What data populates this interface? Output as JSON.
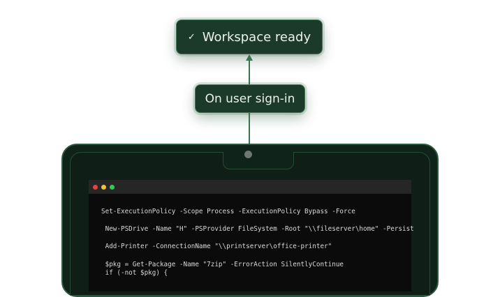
{
  "workflow": {
    "result": {
      "check_glyph": "✓",
      "label": "Workspace ready"
    },
    "trigger": {
      "label": "On user sign-in"
    }
  },
  "terminal": {
    "window_controls": [
      "close",
      "minimize",
      "maximize"
    ],
    "lines": [
      "Set-ExecutionPolicy -Scope Process -ExecutionPolicy Bypass -Force",
      "",
      " New-PSDrive -Name \"H\" -PSProvider FileSystem -Root \"\\\\fileserver\\home\" -Persist",
      "",
      " Add-Printer -ConnectionName \"\\\\printserver\\office-printer\"",
      "",
      " $pkg = Get-Package -Name \"7zip\" -ErrorAction SilentlyContinue",
      " if (-not $pkg) {"
    ]
  },
  "colors": {
    "accent_green": "#1c3a2a",
    "frame_green": "#10231a",
    "terminal_bg": "#0b0b0b"
  }
}
